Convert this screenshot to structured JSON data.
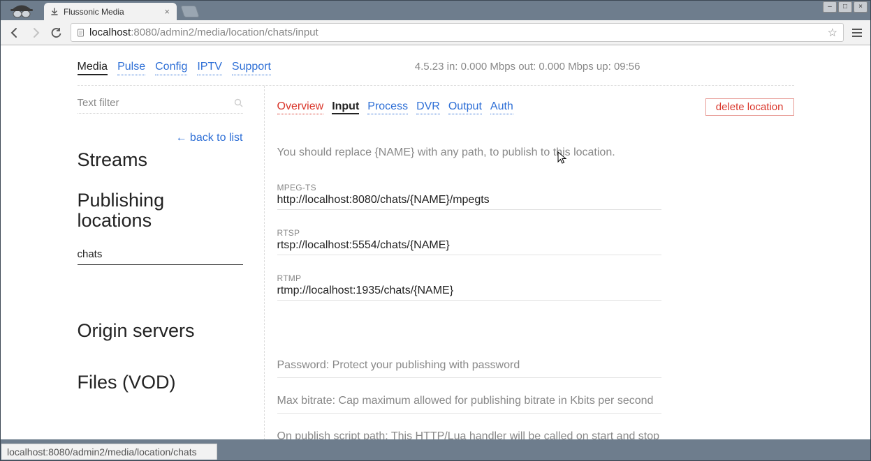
{
  "browser": {
    "tab_title": "Flussonic Media",
    "url_host": "localhost",
    "url_path": ":8080/admin2/media/location/chats/input",
    "status_url": "localhost:8080/admin2/media/location/chats"
  },
  "header": {
    "nav": [
      "Media",
      "Pulse",
      "Config",
      "IPTV",
      "Support"
    ],
    "active_nav_index": 0,
    "status_text": "4.5.23   in: 0.000 Mbps   out: 0.000 Mbps   up: 09:56"
  },
  "sidebar": {
    "filter_placeholder": "Text filter",
    "back_label": "← back to list",
    "sections": {
      "streams": "Streams",
      "publishing": "Publishing locations",
      "selected_location": "chats",
      "origin": "Origin servers",
      "files": "Files (VOD)"
    }
  },
  "main": {
    "tabs": [
      "Overview",
      "Input",
      "Process",
      "DVR",
      "Output",
      "Auth"
    ],
    "active_tab_index": 1,
    "delete_label": "delete location",
    "hint": "You should replace {NAME} with any path, to publish to this location.",
    "urls": [
      {
        "label": "MPEG-TS",
        "value": "http://localhost:8080/chats/{NAME}/mpegts"
      },
      {
        "label": "RTSP",
        "value": "rtsp://localhost:5554/chats/{NAME}"
      },
      {
        "label": "RTMP",
        "value": "rtmp://localhost:1935/chats/{NAME}"
      }
    ],
    "opts": [
      "Password: Protect your publishing with password",
      "Max bitrate: Cap maximum allowed for publishing bitrate in Kbits per second",
      "On publish script path: This HTTP/Lua handler will be called on start and stop of"
    ]
  }
}
